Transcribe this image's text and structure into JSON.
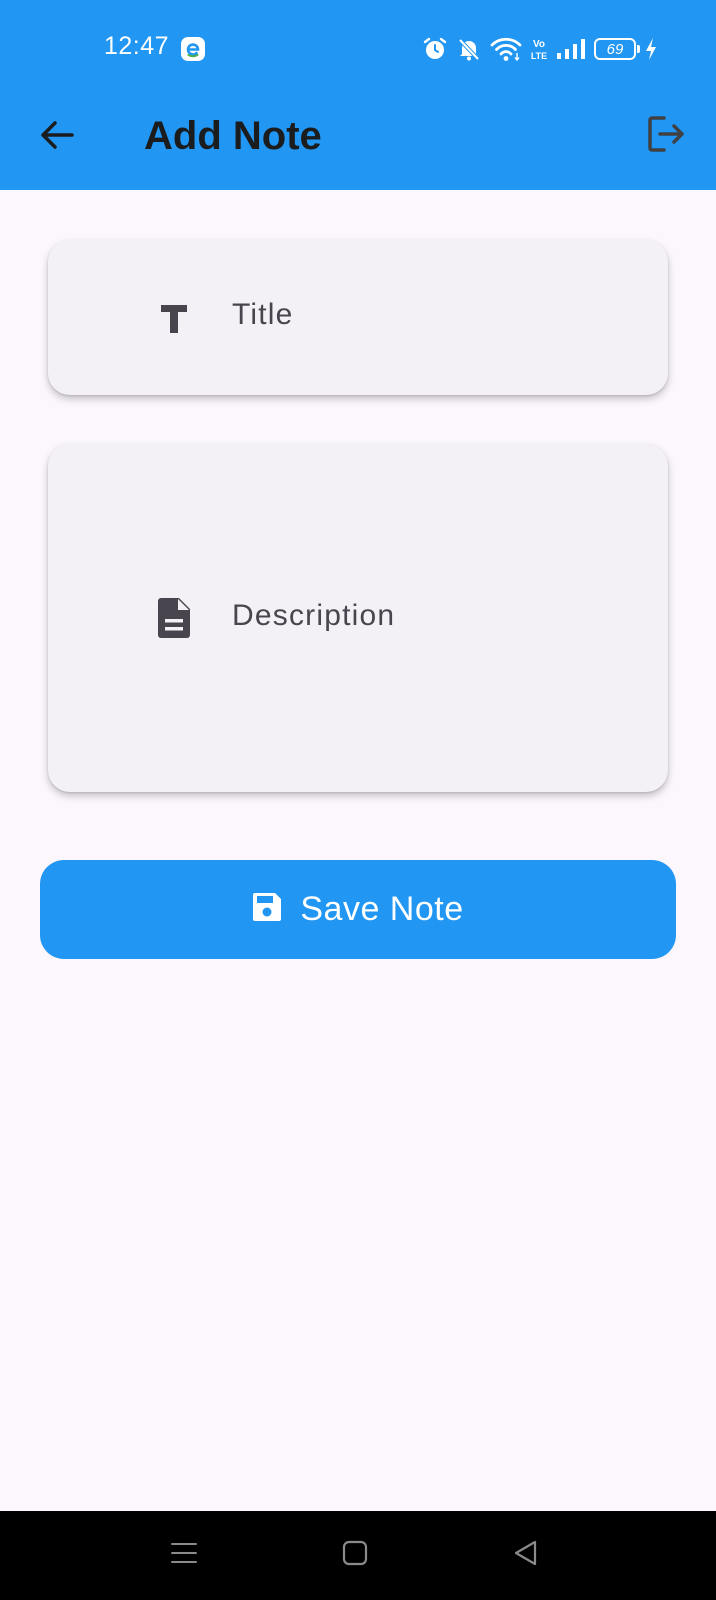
{
  "status_bar": {
    "time": "12:47",
    "battery_level": "69",
    "icons": [
      "app-notification-icon",
      "alarm-icon",
      "bell-off-icon",
      "wifi-icon",
      "volte-icon",
      "signal-icon",
      "battery-icon",
      "charging-icon"
    ]
  },
  "app_bar": {
    "title": "Add Note",
    "back_icon": "arrow-back-icon",
    "logout_icon": "logout-icon",
    "background_color": "#2196F3"
  },
  "form": {
    "title_field": {
      "placeholder": "Title",
      "icon": "text-title-icon",
      "value": ""
    },
    "description_field": {
      "placeholder": "Description",
      "icon": "document-icon",
      "value": ""
    },
    "save_button": {
      "label": "Save Note",
      "icon": "save-icon",
      "color": "#2196F3"
    }
  },
  "nav_bar": {
    "buttons": [
      "menu-icon",
      "home-icon",
      "back-triangle-icon"
    ]
  }
}
